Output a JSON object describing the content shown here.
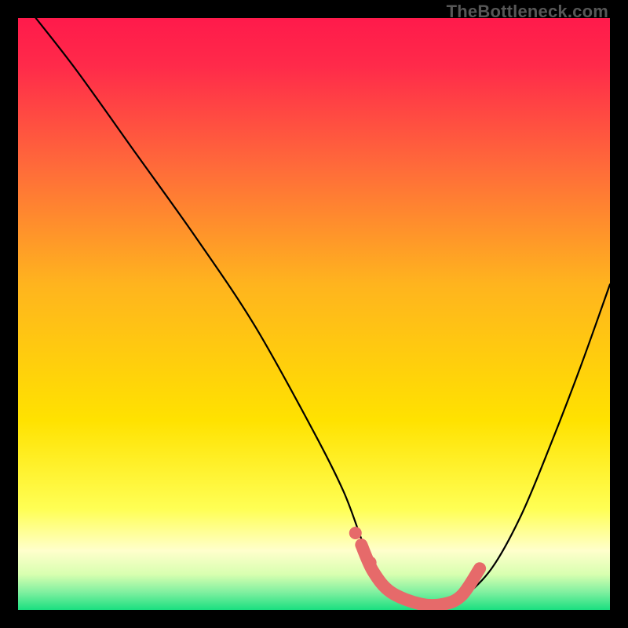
{
  "watermark": "TheBottleneck.com",
  "colors": {
    "frame": "#000000",
    "curve": "#000000",
    "marker_line": "#e66a6a",
    "marker_dot": "#e66a6a",
    "grad_top": "#ff1a4b",
    "grad_mid": "#ffe200",
    "grad_white": "#ffffcc",
    "grad_green": "#1adf80"
  },
  "chart_data": {
    "type": "line",
    "title": "",
    "xlabel": "",
    "ylabel": "",
    "xlim": [
      0,
      100
    ],
    "ylim": [
      0,
      100
    ],
    "curve": {
      "x": [
        3,
        10,
        20,
        30,
        40,
        50,
        55,
        58,
        60,
        63,
        68,
        72,
        75,
        80,
        85,
        90,
        95,
        100
      ],
      "y": [
        100,
        91,
        77,
        63,
        48,
        30,
        20,
        12,
        7,
        3,
        1,
        1,
        2,
        7,
        16,
        28,
        41,
        55
      ]
    },
    "highlight_segment": {
      "x": [
        58,
        60,
        63,
        68,
        72,
        75,
        78
      ],
      "y": [
        11,
        6.5,
        3,
        1,
        1,
        2.5,
        7
      ]
    },
    "highlight_dots": [
      {
        "x": 57,
        "y": 13
      },
      {
        "x": 59.5,
        "y": 8
      }
    ]
  }
}
